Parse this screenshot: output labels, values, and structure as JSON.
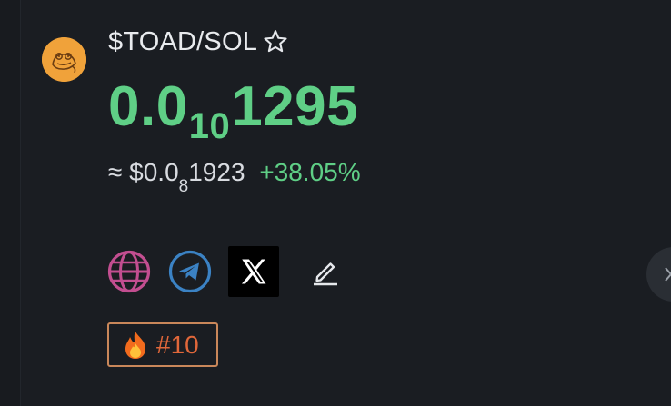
{
  "token": {
    "pair": "$TOAD/SOL",
    "price": {
      "lead": "0.0",
      "zero_count": "10",
      "digits": "1295"
    },
    "usd": {
      "prefix": "≈ $0.0",
      "zero_count": "8",
      "digits": "1923"
    },
    "change_pct": "+38.05%"
  },
  "badge": {
    "rank": "#10"
  },
  "colors": {
    "positive": "#5fcf86",
    "avatar_bg": "#f0a23a",
    "website": "#c24e90",
    "telegram": "#3b82c4",
    "badge_border": "#c9875a",
    "badge_text": "#e0673a"
  },
  "icons": {
    "favorite": "star-icon",
    "website": "globe-icon",
    "telegram": "telegram-icon",
    "x": "x-logo-icon",
    "edit": "pencil-icon",
    "rank": "fire-icon"
  }
}
